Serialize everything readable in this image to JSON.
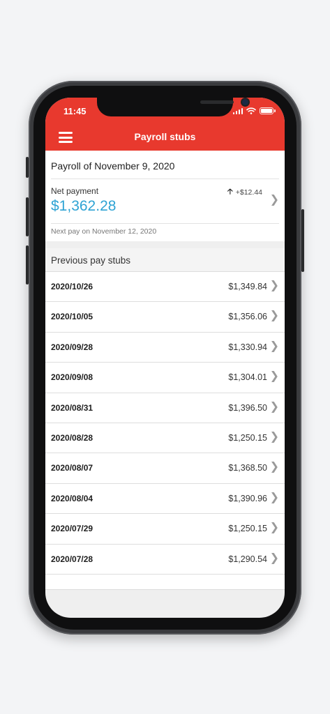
{
  "status_bar": {
    "time": "11:45"
  },
  "nav": {
    "title": "Payroll stubs",
    "menu_icon": "hamburger-menu-icon"
  },
  "current_payroll": {
    "title": "Payroll of November 9, 2020",
    "net_label": "Net payment",
    "net_amount": "$1,362.28",
    "change": "+$12.44",
    "change_icon": "arrow-up-icon",
    "next_pay": "Next pay on November 12, 2020"
  },
  "previous": {
    "header": "Previous pay stubs",
    "stubs": [
      {
        "date": "2020/10/26",
        "amount": "$1,349.84"
      },
      {
        "date": "2020/10/05",
        "amount": "$1,356.06"
      },
      {
        "date": "2020/09/28",
        "amount": "$1,330.94"
      },
      {
        "date": "2020/09/08",
        "amount": "$1,304.01"
      },
      {
        "date": "2020/08/31",
        "amount": "$1,396.50"
      },
      {
        "date": "2020/08/28",
        "amount": "$1,250.15"
      },
      {
        "date": "2020/08/07",
        "amount": "$1,368.50"
      },
      {
        "date": "2020/08/04",
        "amount": "$1,390.96"
      },
      {
        "date": "2020/07/29",
        "amount": "$1,250.15"
      },
      {
        "date": "2020/07/28",
        "amount": "$1,290.54"
      }
    ]
  },
  "colors": {
    "accent_red": "#e8392e",
    "amount_blue": "#2ea3d4"
  }
}
